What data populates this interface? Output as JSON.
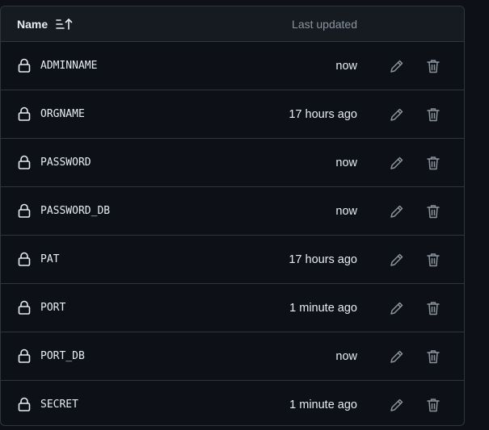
{
  "header": {
    "name_label": "Name",
    "last_updated_label": "Last updated",
    "sort_icon": "sort-ascending-icon"
  },
  "secrets": [
    {
      "name": "ADMINNAME",
      "updated": "now"
    },
    {
      "name": "ORGNAME",
      "updated": "17 hours ago"
    },
    {
      "name": "PASSWORD",
      "updated": "now"
    },
    {
      "name": "PASSWORD_DB",
      "updated": "now"
    },
    {
      "name": "PAT",
      "updated": "17 hours ago"
    },
    {
      "name": "PORT",
      "updated": "1 minute ago"
    },
    {
      "name": "PORT_DB",
      "updated": "now"
    },
    {
      "name": "SECRET",
      "updated": "1 minute ago"
    }
  ],
  "icons": {
    "lock": "lock-icon",
    "edit": "pencil-icon",
    "delete": "trash-icon"
  },
  "colors": {
    "background": "#0d1117",
    "header_background": "#161b22",
    "border": "#30363d",
    "text": "#e6edf3",
    "muted": "#8b949e"
  }
}
